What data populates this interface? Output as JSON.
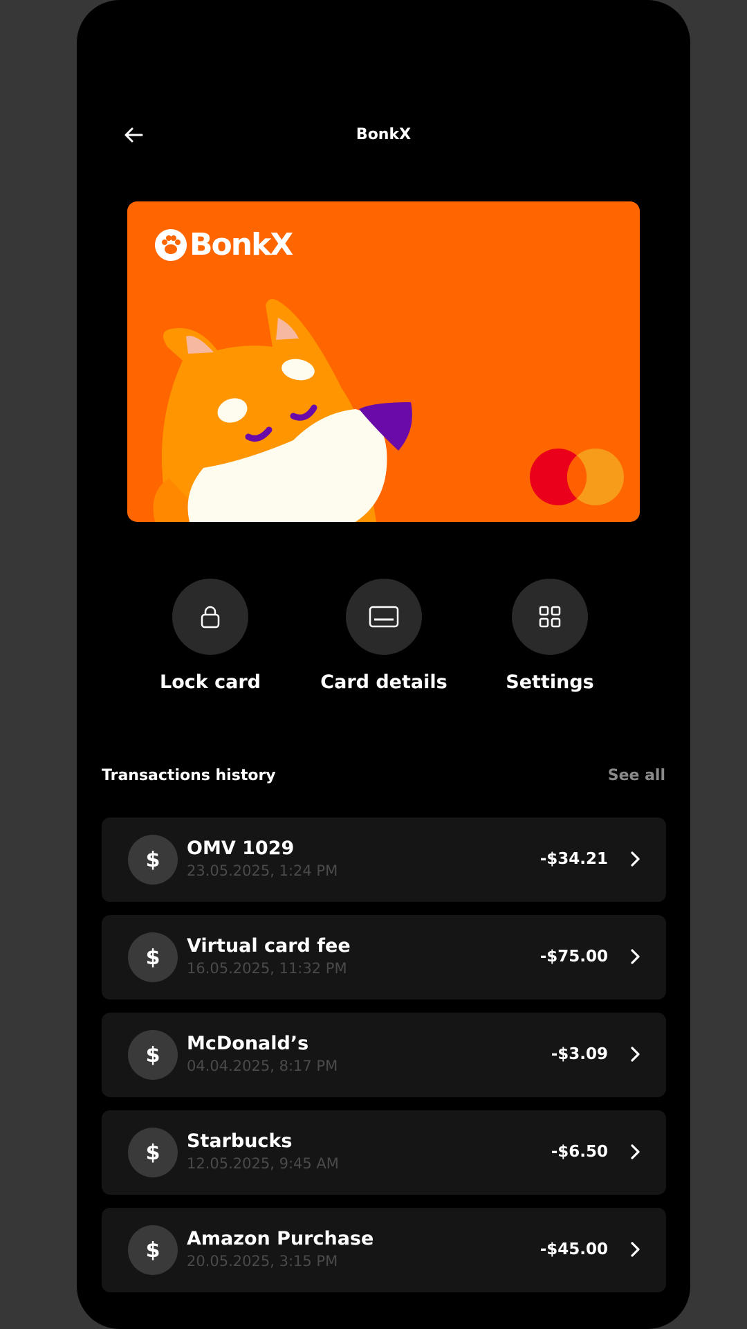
{
  "header": {
    "title": "BonkX",
    "back_icon": "arrow-left-icon"
  },
  "card": {
    "brand": "BonkX",
    "network_icon": "mastercard-logo",
    "color": "#ff6600"
  },
  "actions": [
    {
      "label": "Lock card",
      "icon": "lock-icon"
    },
    {
      "label": "Card details",
      "icon": "credit-card-icon"
    },
    {
      "label": "Settings",
      "icon": "grid-icon"
    }
  ],
  "transactions": {
    "title": "Transactions history",
    "see_all": "See all",
    "items": [
      {
        "icon_glyph": "$",
        "name": "OMV 1029",
        "date": "23.05.2025, 1:24 PM",
        "amount": "-$34.21"
      },
      {
        "icon_glyph": "$",
        "name": "Virtual card fee",
        "date": "16.05.2025, 11:32 PM",
        "amount": "-$75.00"
      },
      {
        "icon_glyph": "$",
        "name": "McDonald’s",
        "date": "04.04.2025, 8:17 PM",
        "amount": "-$3.09"
      },
      {
        "icon_glyph": "$",
        "name": "Starbucks",
        "date": "12.05.2025, 9:45 AM",
        "amount": "-$6.50"
      },
      {
        "icon_glyph": "$",
        "name": "Amazon Purchase",
        "date": "20.05.2025, 3:15 PM",
        "amount": "-$45.00"
      }
    ]
  }
}
